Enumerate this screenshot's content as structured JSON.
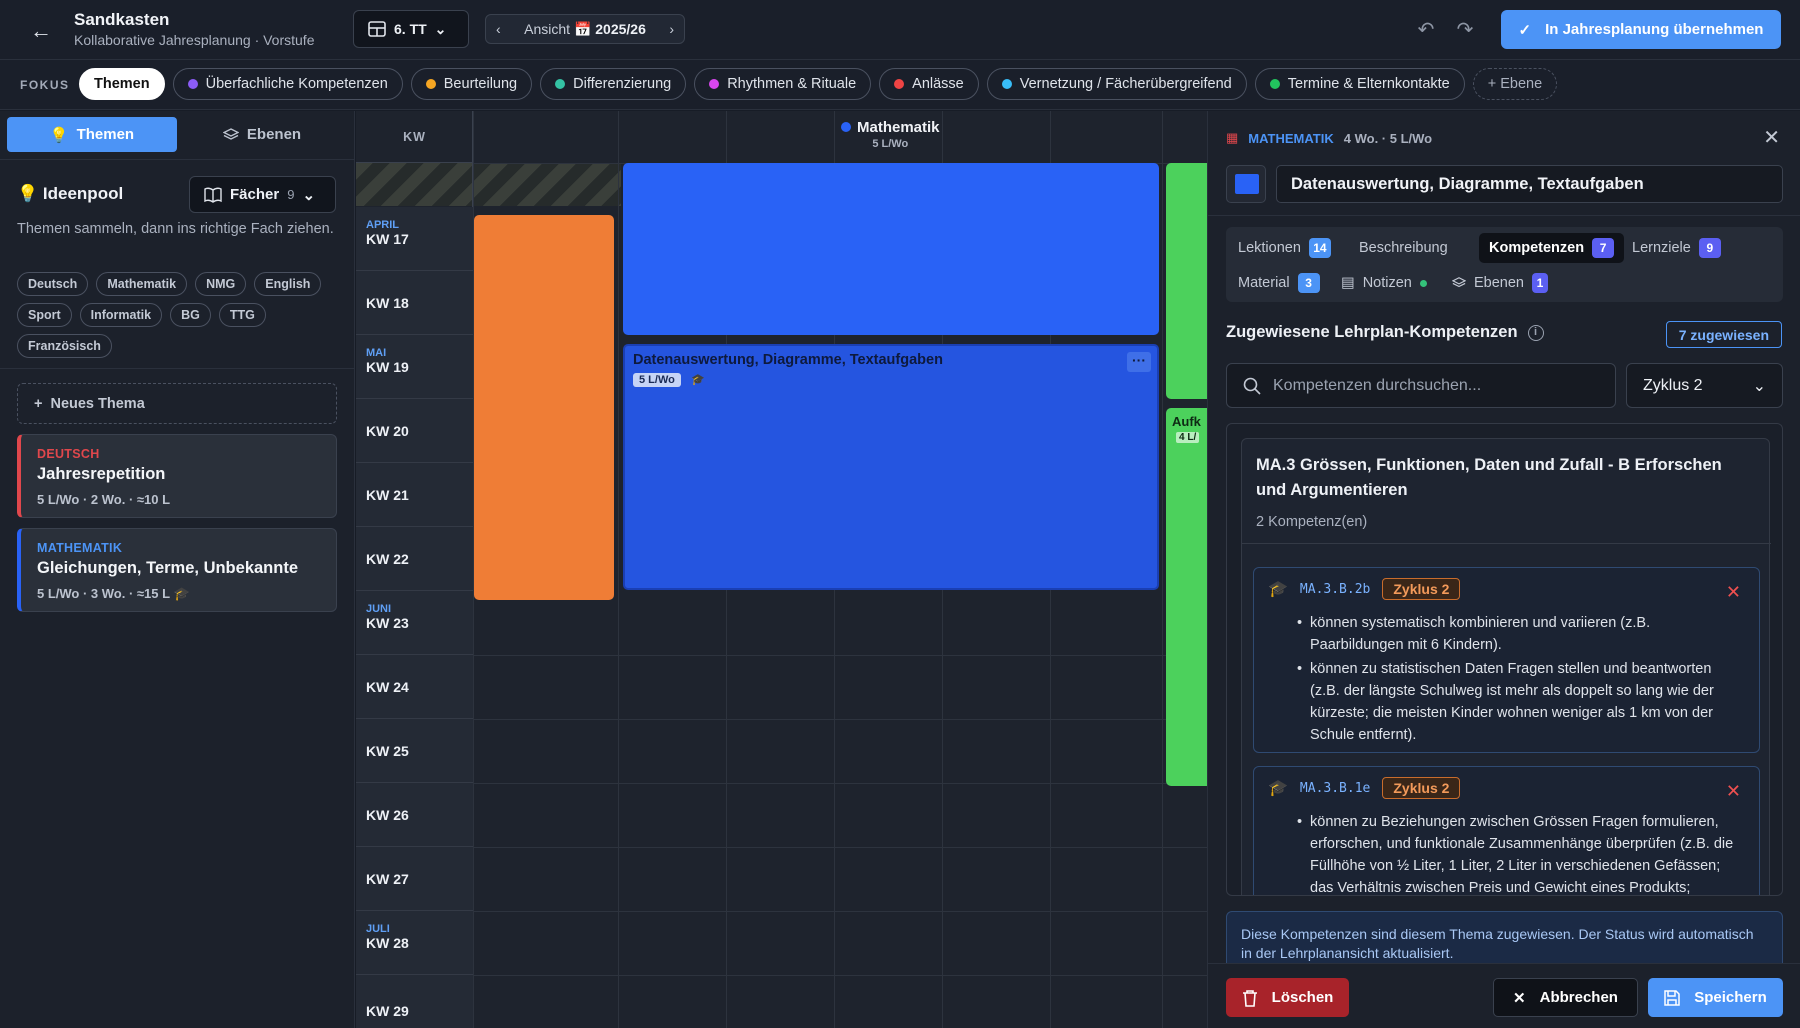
{
  "header": {
    "title": "Sandkasten",
    "subtitle": "Kollaborative Jahresplanung · Vorstufe",
    "class_select": "6. TT",
    "view_label": "Ansicht",
    "view_icon": "📅",
    "view_year": "2025/26",
    "apply_button": "In Jahresplanung übernehmen"
  },
  "focus": {
    "label": "FOKUS",
    "chips": [
      {
        "label": "Themen",
        "color": null
      },
      {
        "label": "Überfachliche Kompetenzen",
        "color": "#8b5cf6"
      },
      {
        "label": "Beurteilung",
        "color": "#f5a623"
      },
      {
        "label": "Differenzierung",
        "color": "#34c2a4"
      },
      {
        "label": "Rhythmen & Rituale",
        "color": "#d946ef"
      },
      {
        "label": "Anlässe",
        "color": "#ef4444"
      },
      {
        "label": "Vernetzung / Fächerübergreifend",
        "color": "#38bdf8"
      },
      {
        "label": "Termine & Elternkontakte",
        "color": "#22c55e"
      }
    ],
    "add_layer": "+ Ebene"
  },
  "sidebar": {
    "tab_themes": "Themen",
    "tab_layers": "Ebenen",
    "pool_icon": "💡",
    "pool_title": "Ideenpool",
    "subjects_button": "Fächer",
    "subjects_count": "9",
    "pool_description": "Themen sammeln, dann ins richtige Fach ziehen.",
    "tags": [
      "Deutsch",
      "Mathematik",
      "NMG",
      "English",
      "Sport",
      "Informatik",
      "BG",
      "TTG",
      "Französisch"
    ],
    "new_theme": "Neues Thema",
    "cards": [
      {
        "subject": "DEUTSCH",
        "title": "Jahresrepetition",
        "meta": "5 L/Wo · 2 Wo. · ≈10 L",
        "color": "#e0474c"
      },
      {
        "subject": "MATHEMATIK",
        "title": "Gleichungen, Terme, Unbekannte",
        "meta": "5 L/Wo · 3 Wo. · ≈15 L",
        "color": "#2962f6"
      }
    ]
  },
  "grid": {
    "kw_header": "KW",
    "weeks": [
      {
        "month": "APRIL",
        "kw": "KW 17"
      },
      {
        "month": "",
        "kw": "KW 18"
      },
      {
        "month": "MAI",
        "kw": "KW 19"
      },
      {
        "month": "",
        "kw": "KW 20"
      },
      {
        "month": "",
        "kw": "KW 21"
      },
      {
        "month": "",
        "kw": "KW 22"
      },
      {
        "month": "JUNI",
        "kw": "KW 23"
      },
      {
        "month": "",
        "kw": "KW 24"
      },
      {
        "month": "",
        "kw": "KW 25"
      },
      {
        "month": "",
        "kw": "KW 26"
      },
      {
        "month": "",
        "kw": "KW 27"
      },
      {
        "month": "JULI",
        "kw": "KW 28"
      },
      {
        "month": "",
        "kw": "KW 29"
      }
    ],
    "subject_column": {
      "name": "Mathematik",
      "rate": "5 L/Wo",
      "color": "#2962f6"
    },
    "selected_block": {
      "title": "Datenauswertung, Diagramme, Textaufgaben",
      "badge": "5 L/Wo",
      "more": "···"
    },
    "green_block": {
      "title": "Aufk",
      "badge": "4 L/"
    }
  },
  "detail": {
    "subject": "MATHEMATIK",
    "meta": "4 Wo. · 5 L/Wo",
    "title": "Datenauswertung, Diagramme, Textaufgaben",
    "tabs": [
      {
        "label": "Lektionen",
        "count": "14"
      },
      {
        "label": "Beschreibung",
        "count": ""
      },
      {
        "label": "Kompetenzen",
        "count": "7"
      },
      {
        "label": "Lernziele",
        "count": "9"
      },
      {
        "label": "Material",
        "count": "3"
      },
      {
        "label": "Notizen",
        "count": ""
      },
      {
        "label": "Ebenen",
        "count": "1"
      }
    ],
    "section_title": "Zugewiesene Lehrplan-Kompetenzen",
    "assigned_badge": "7 zugewiesen",
    "search_placeholder": "Kompetenzen durchsuchen...",
    "cycle_select": "Zyklus 2",
    "group": {
      "title": "MA.3 Grössen, Funktionen, Daten und Zufall - B Erforschen und Argumentieren",
      "count": "2 Kompetenz(en)",
      "items": [
        {
          "code": "MA.3.B.2b",
          "cycle": "Zyklus 2",
          "points": [
            "können systematisch kombinieren und variieren (z.B. Paarbildungen mit 6 Kindern).",
            "können zu statistischen Daten Fragen stellen und beantworten (z.B. der längste Schulweg ist mehr als doppelt so lang wie der kürzeste; die meisten Kinder wohnen weniger als 1 km von der Schule entfernt)."
          ]
        },
        {
          "code": "MA.3.B.1e",
          "cycle": "Zyklus 2",
          "points": [
            "können zu Beziehungen zwischen Grössen Fragen formulieren, erforschen, und funktionale Zusammenhänge überprüfen (z.B. die Füllhöhe von ½ Liter, 1 Liter, 2 Liter in verschiedenen Gefässen; das Verhältnis zwischen Preis und Gewicht eines Produkts;"
          ]
        }
      ]
    },
    "note": "Diese Kompetenzen sind diesem Thema zugewiesen. Der Status wird automatisch in der Lehrplanansicht aktualisiert.",
    "delete_button": "Löschen",
    "cancel_button": "Abbrechen",
    "save_button": "Speichern"
  }
}
